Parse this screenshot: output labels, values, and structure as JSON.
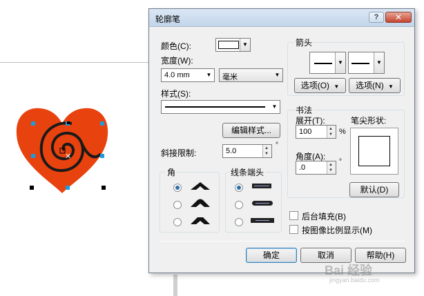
{
  "dialog": {
    "title": "轮廓笔",
    "help_glyph": "?",
    "close_glyph": "✕"
  },
  "color": {
    "label": "颜色(C):"
  },
  "width": {
    "label": "宽度(W):",
    "value": "4.0 mm",
    "unit": "毫米"
  },
  "style": {
    "label": "样式(S):",
    "edit_button": "编辑样式..."
  },
  "miter": {
    "label": "斜接限制:",
    "value": "5.0",
    "unit": "°"
  },
  "corners": {
    "label": "角",
    "selected_index": 0
  },
  "linecaps": {
    "label": "线条端头",
    "selected_index": 0
  },
  "arrows": {
    "label": "箭头",
    "left_options": "选项(O)",
    "right_options": "选项(N)"
  },
  "calligraphy": {
    "label": "书法",
    "stretch_label": "展开(T):",
    "stretch_value": "100",
    "stretch_unit": "%",
    "angle_label": "角度(A):",
    "angle_value": ".0",
    "angle_unit": "°",
    "nib_label": "笔尖形状:",
    "default_button": "默认(D)"
  },
  "options": {
    "behind_fill": "后台填充(B)",
    "scale_with_image": "按图像比例显示(M)"
  },
  "footer": {
    "ok": "确定",
    "cancel": "取消",
    "help": "帮助(H)"
  },
  "watermark": {
    "line1": "Bai 经验",
    "line2": "jingyan.baidu.com"
  },
  "colors": {
    "heart_fill": "#e8420e",
    "spiral": "#1a1a1a",
    "handle": "#1e9be0",
    "outline_color": "#ffffff"
  }
}
